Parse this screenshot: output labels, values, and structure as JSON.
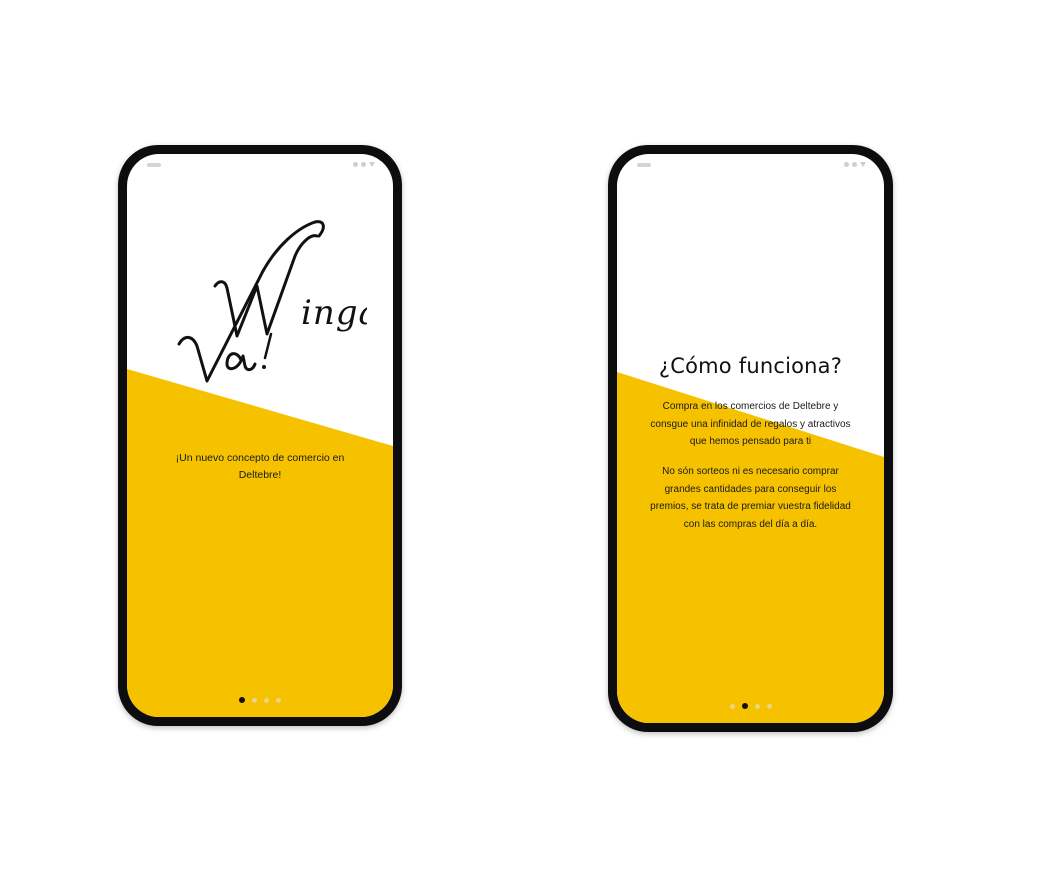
{
  "slides": [
    {
      "logo_text": "Vinga Va!",
      "tagline": "¡Un nuevo concepto de comercio en Deltebre!",
      "dots": [
        true,
        false,
        false,
        false
      ]
    },
    {
      "title": "¿Cómo funciona?",
      "paragraph_1": "Compra en los comercios de Deltebre y consgue una infinidad de regalos y atractivos que hemos pensado para ti",
      "paragraph_2": "No són sorteos ni es necesario comprar grandes cantidades para conseguir los premios, se trata de premiar vuestra fidelidad con las compras del día a día.",
      "dots": [
        false,
        true,
        false,
        false
      ]
    }
  ],
  "colors": {
    "accent": "#f6c200",
    "frame": "#0d0d0f"
  }
}
